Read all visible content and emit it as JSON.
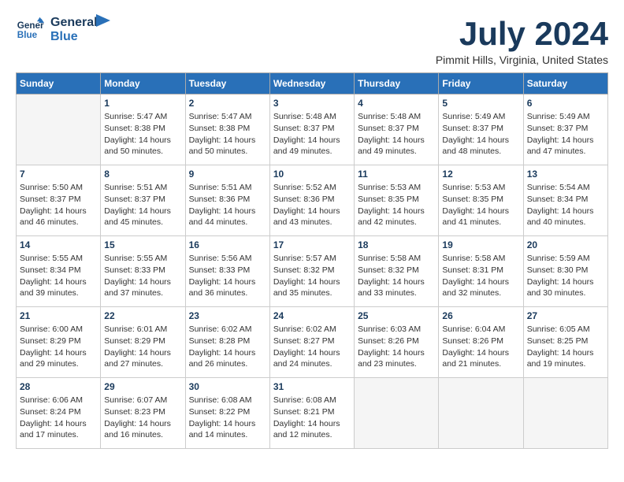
{
  "logo": {
    "line1": "General",
    "line2": "Blue"
  },
  "title": "July 2024",
  "location": "Pimmit Hills, Virginia, United States",
  "weekdays": [
    "Sunday",
    "Monday",
    "Tuesday",
    "Wednesday",
    "Thursday",
    "Friday",
    "Saturday"
  ],
  "weeks": [
    [
      {
        "day": "",
        "info": ""
      },
      {
        "day": "1",
        "info": "Sunrise: 5:47 AM\nSunset: 8:38 PM\nDaylight: 14 hours\nand 50 minutes."
      },
      {
        "day": "2",
        "info": "Sunrise: 5:47 AM\nSunset: 8:38 PM\nDaylight: 14 hours\nand 50 minutes."
      },
      {
        "day": "3",
        "info": "Sunrise: 5:48 AM\nSunset: 8:37 PM\nDaylight: 14 hours\nand 49 minutes."
      },
      {
        "day": "4",
        "info": "Sunrise: 5:48 AM\nSunset: 8:37 PM\nDaylight: 14 hours\nand 49 minutes."
      },
      {
        "day": "5",
        "info": "Sunrise: 5:49 AM\nSunset: 8:37 PM\nDaylight: 14 hours\nand 48 minutes."
      },
      {
        "day": "6",
        "info": "Sunrise: 5:49 AM\nSunset: 8:37 PM\nDaylight: 14 hours\nand 47 minutes."
      }
    ],
    [
      {
        "day": "7",
        "info": ""
      },
      {
        "day": "8",
        "info": "Sunrise: 5:51 AM\nSunset: 8:37 PM\nDaylight: 14 hours\nand 45 minutes."
      },
      {
        "day": "9",
        "info": "Sunrise: 5:51 AM\nSunset: 8:36 PM\nDaylight: 14 hours\nand 44 minutes."
      },
      {
        "day": "10",
        "info": "Sunrise: 5:52 AM\nSunset: 8:36 PM\nDaylight: 14 hours\nand 43 minutes."
      },
      {
        "day": "11",
        "info": "Sunrise: 5:53 AM\nSunset: 8:35 PM\nDaylight: 14 hours\nand 42 minutes."
      },
      {
        "day": "12",
        "info": "Sunrise: 5:53 AM\nSunset: 8:35 PM\nDaylight: 14 hours\nand 41 minutes."
      },
      {
        "day": "13",
        "info": "Sunrise: 5:54 AM\nSunset: 8:34 PM\nDaylight: 14 hours\nand 40 minutes."
      }
    ],
    [
      {
        "day": "14",
        "info": ""
      },
      {
        "day": "15",
        "info": "Sunrise: 5:55 AM\nSunset: 8:33 PM\nDaylight: 14 hours\nand 37 minutes."
      },
      {
        "day": "16",
        "info": "Sunrise: 5:56 AM\nSunset: 8:33 PM\nDaylight: 14 hours\nand 36 minutes."
      },
      {
        "day": "17",
        "info": "Sunrise: 5:57 AM\nSunset: 8:32 PM\nDaylight: 14 hours\nand 35 minutes."
      },
      {
        "day": "18",
        "info": "Sunrise: 5:58 AM\nSunset: 8:32 PM\nDaylight: 14 hours\nand 33 minutes."
      },
      {
        "day": "19",
        "info": "Sunrise: 5:58 AM\nSunset: 8:31 PM\nDaylight: 14 hours\nand 32 minutes."
      },
      {
        "day": "20",
        "info": "Sunrise: 5:59 AM\nSunset: 8:30 PM\nDaylight: 14 hours\nand 30 minutes."
      }
    ],
    [
      {
        "day": "21",
        "info": ""
      },
      {
        "day": "22",
        "info": "Sunrise: 6:01 AM\nSunset: 8:29 PM\nDaylight: 14 hours\nand 27 minutes."
      },
      {
        "day": "23",
        "info": "Sunrise: 6:02 AM\nSunset: 8:28 PM\nDaylight: 14 hours\nand 26 minutes."
      },
      {
        "day": "24",
        "info": "Sunrise: 6:02 AM\nSunset: 8:27 PM\nDaylight: 14 hours\nand 24 minutes."
      },
      {
        "day": "25",
        "info": "Sunrise: 6:03 AM\nSunset: 8:26 PM\nDaylight: 14 hours\nand 23 minutes."
      },
      {
        "day": "26",
        "info": "Sunrise: 6:04 AM\nSunset: 8:26 PM\nDaylight: 14 hours\nand 21 minutes."
      },
      {
        "day": "27",
        "info": "Sunrise: 6:05 AM\nSunset: 8:25 PM\nDaylight: 14 hours\nand 19 minutes."
      }
    ],
    [
      {
        "day": "28",
        "info": ""
      },
      {
        "day": "29",
        "info": "Sunrise: 6:07 AM\nSunset: 8:23 PM\nDaylight: 14 hours\nand 16 minutes."
      },
      {
        "day": "30",
        "info": "Sunrise: 6:08 AM\nSunset: 8:22 PM\nDaylight: 14 hours\nand 14 minutes."
      },
      {
        "day": "31",
        "info": "Sunrise: 6:08 AM\nSunset: 8:21 PM\nDaylight: 14 hours\nand 12 minutes."
      },
      {
        "day": "",
        "info": ""
      },
      {
        "day": "",
        "info": ""
      },
      {
        "day": "",
        "info": ""
      }
    ]
  ],
  "week1_day7_info": "Sunrise: 5:50 AM\nSunset: 8:37 PM\nDaylight: 14 hours\nand 46 minutes.",
  "week2_day14_info": "Sunrise: 5:55 AM\nSunset: 8:34 PM\nDaylight: 14 hours\nand 39 minutes.",
  "week3_day21_info": "Sunrise: 6:00 AM\nSunset: 8:29 PM\nDaylight: 14 hours\nand 29 minutes.",
  "week4_day28_info": "Sunrise: 6:06 AM\nSunset: 8:24 PM\nDaylight: 14 hours\nand 17 minutes."
}
